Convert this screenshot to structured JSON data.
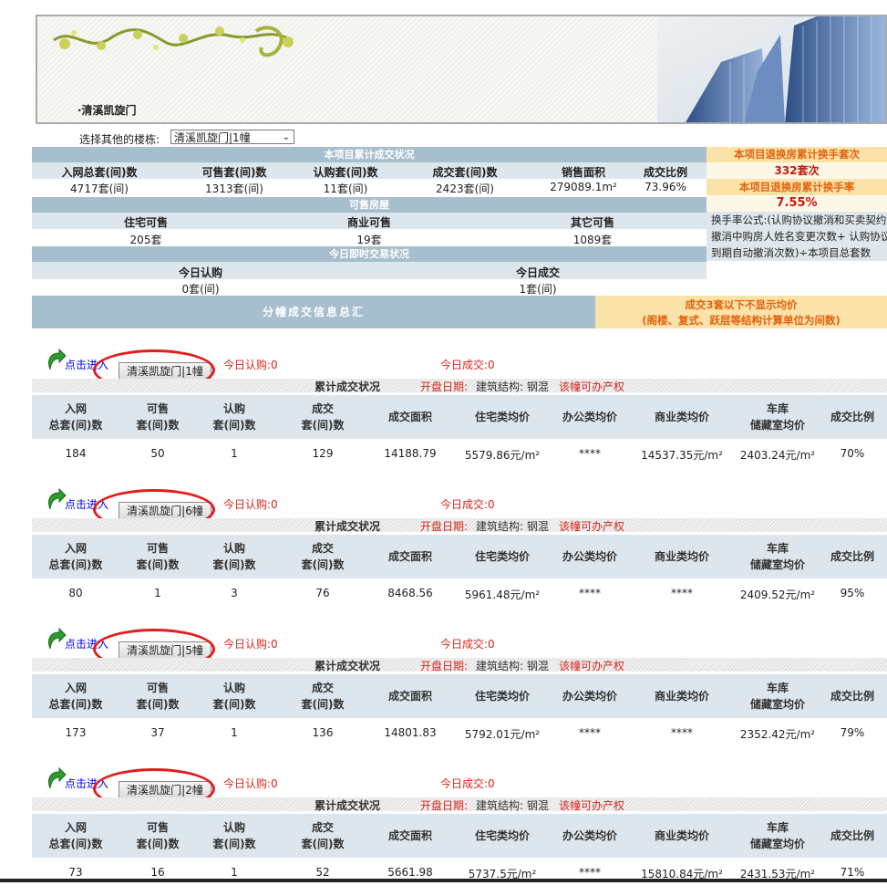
{
  "header": {
    "project_name": "·清溪凯旋门"
  },
  "selector": {
    "label": "选择其他的楼栋:",
    "value": "清溪凯旋门|1幢"
  },
  "cumulative": {
    "title": "本项目累计成交状况",
    "columns": [
      "入网总套(间)数",
      "可售套(间)数",
      "认购套(间)数",
      "成交套(间)数",
      "销售面积",
      "成交比例"
    ],
    "values": [
      "4717套(间)",
      "1313套(间)",
      "11套(间)",
      "2423套(间)",
      "279089.1m²",
      "73.96%"
    ]
  },
  "exchange": {
    "count_title": "本项目退换房累计换手套次",
    "count_value": "332套次",
    "rate_title": "本项目退换房累计换手率",
    "rate_value": "7.55%",
    "formula_lines": [
      "换手率公式:(认购协议撤消和买卖契约",
      "撤消中购房人姓名变更次数+ 认购协议",
      "到期自动撤消次数)÷本项目总套数"
    ]
  },
  "available": {
    "title": "可售房屋",
    "columns": [
      "住宅可售",
      "商业可售",
      "其它可售"
    ],
    "values": [
      "205套",
      "19套",
      "1089套"
    ]
  },
  "today": {
    "title": "今日即时交易状况",
    "columns": [
      "今日认购",
      "今日成交"
    ],
    "values": [
      "0套(间)",
      "1套(间)"
    ]
  },
  "summary": {
    "title": "分幢成交信息总汇",
    "note_line1": "成交3套以下不显示均价",
    "note_line2": "(阁楼、复式、跃层等结构计算单位为间数)"
  },
  "building_common": {
    "enter_label": "点击进入",
    "cumulative_label": "累计成交状况",
    "open_date_label": "开盘日期:",
    "structure_label": "建筑结构: 钢混",
    "certificate_label": "该幢可办产权",
    "headers": [
      [
        "入网",
        "总套(间)数"
      ],
      [
        "可售",
        "套(间)数"
      ],
      [
        "认购",
        "套(间)数"
      ],
      [
        "成交",
        "套(间)数"
      ],
      [
        "成交面积"
      ],
      [
        "住宅类均价"
      ],
      [
        "办公类均价"
      ],
      [
        "商业类均价"
      ],
      [
        "车库",
        "储藏室均价"
      ],
      [
        "成交比例"
      ]
    ]
  },
  "buildings": [
    {
      "name": "清溪凯旋门|1幢",
      "today_subscribe": "今日认购:0",
      "today_deal": "今日成交:0",
      "values": [
        "184",
        "50",
        "1",
        "129",
        "14188.79",
        "5579.86元/m²",
        "****",
        "14537.35元/m²",
        "2403.24元/m²",
        "70%"
      ]
    },
    {
      "name": "清溪凯旋门|6幢",
      "today_subscribe": "今日认购:0",
      "today_deal": "今日成交:0",
      "values": [
        "80",
        "1",
        "3",
        "76",
        "8468.56",
        "5961.48元/m²",
        "****",
        "****",
        "2409.52元/m²",
        "95%"
      ]
    },
    {
      "name": "清溪凯旋门|5幢",
      "today_subscribe": "今日认购:0",
      "today_deal": "今日成交:0",
      "values": [
        "173",
        "37",
        "1",
        "136",
        "14801.83",
        "5792.01元/m²",
        "****",
        "****",
        "2352.42元/m²",
        "79%"
      ]
    },
    {
      "name": "清溪凯旋门|2幢",
      "today_subscribe": "今日认购:0",
      "today_deal": "今日成交:0",
      "values": [
        "73",
        "16",
        "1",
        "52",
        "5661.98",
        "5737.5元/m²",
        "****",
        "15810.84元/m²",
        "2431.53元/m²",
        "71%"
      ]
    }
  ]
}
